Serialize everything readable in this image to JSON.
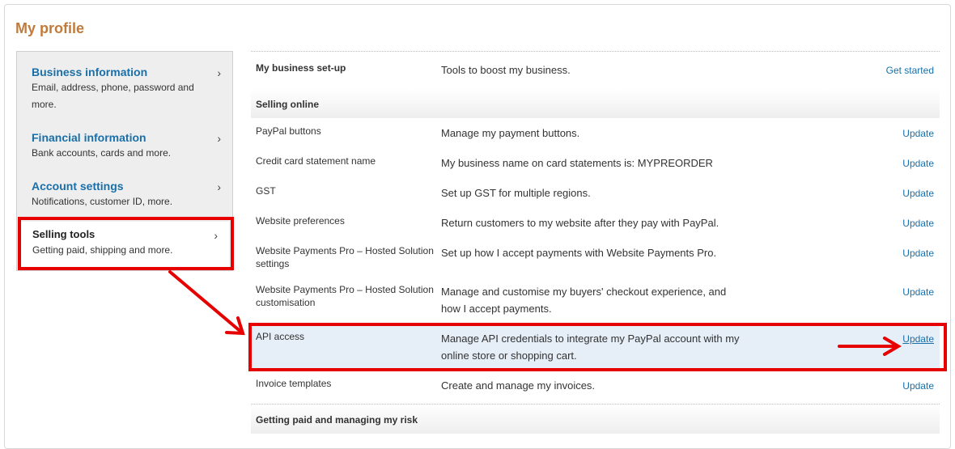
{
  "page": {
    "title": "My profile"
  },
  "sidebar": {
    "items": [
      {
        "title": "Business information",
        "desc": "Email, address, phone, password and more."
      },
      {
        "title": "Financial information",
        "desc": "Bank accounts, cards and more."
      },
      {
        "title": "Account settings",
        "desc": "Notifications, customer ID, more."
      },
      {
        "title": "Selling tools",
        "desc": "Getting paid, shipping and more."
      }
    ]
  },
  "main": {
    "setup": {
      "label": "My business set-up",
      "desc": "Tools to boost my business.",
      "action": "Get started"
    },
    "sections": {
      "selling_online": "Selling online",
      "getting_paid": "Getting paid and managing my risk"
    },
    "rows": [
      {
        "label": "PayPal buttons",
        "desc": "Manage my payment buttons.",
        "action": "Update"
      },
      {
        "label": "Credit card statement name",
        "desc": "My business name on card statements is: MYPREORDER",
        "action": "Update"
      },
      {
        "label": "GST",
        "desc": "Set up GST for multiple regions.",
        "action": "Update"
      },
      {
        "label": "Website preferences",
        "desc": "Return customers to my website after they pay with PayPal.",
        "action": "Update"
      },
      {
        "label": "Website Payments Pro – Hosted Solution settings",
        "desc": "Set up how I accept payments with Website Payments Pro.",
        "action": "Update"
      },
      {
        "label": "Website Payments Pro – Hosted Solution customisation",
        "desc": "Manage and customise my buyers' checkout experience, and how I accept payments.",
        "action": "Update"
      },
      {
        "label": "API access",
        "desc": "Manage API credentials to integrate my PayPal account with my online store or shopping cart.",
        "action": "Update"
      },
      {
        "label": "Invoice templates",
        "desc": "Create and manage my invoices.",
        "action": "Update"
      }
    ]
  },
  "icons": {
    "chevron": "chevron-right-icon"
  },
  "colors": {
    "title": "#c07a3a",
    "link": "#1a6fa8",
    "annotation": "#e60000",
    "highlight": "#e6eef7"
  }
}
